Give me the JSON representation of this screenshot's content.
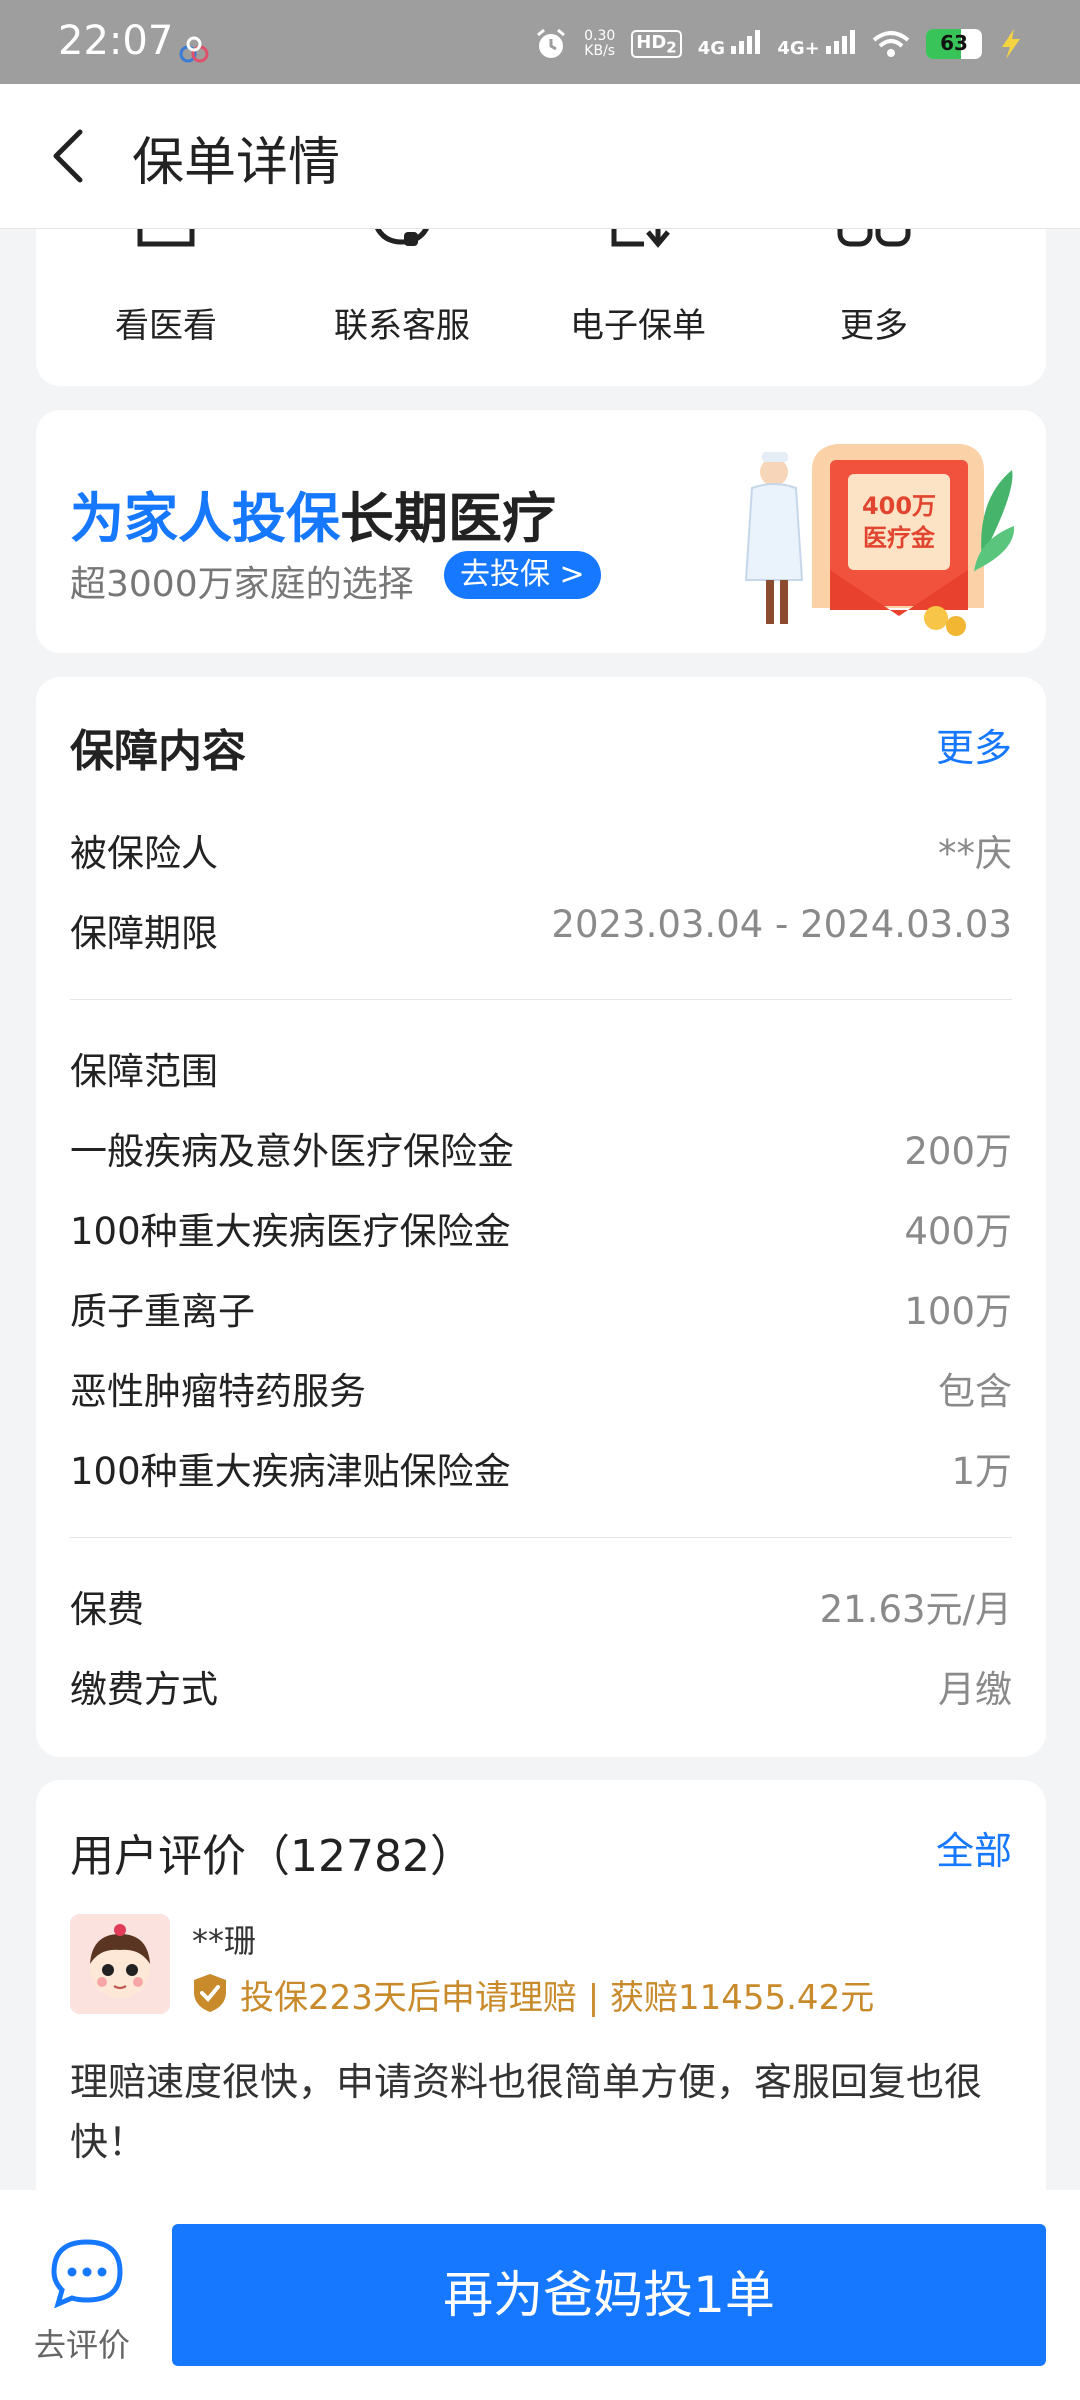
{
  "status_bar": {
    "time": "22:07",
    "net_speed_value": "0.30",
    "net_speed_unit": "KB/s",
    "hd": "HD",
    "hd_sub": "2",
    "signal1": "4G",
    "signal2": "4G+",
    "battery": "63",
    "battery_level_percent": 63
  },
  "header": {
    "title": "保单详情"
  },
  "quick_actions": [
    {
      "label": "看医看",
      "icon": "clipboard-icon"
    },
    {
      "label": "联系客服",
      "icon": "headset-icon"
    },
    {
      "label": "电子保单",
      "icon": "document-download-icon"
    },
    {
      "label": "更多",
      "icon": "more-grid-icon"
    }
  ],
  "promo": {
    "title_highlight": "为家人投保",
    "title_rest": "长期医疗",
    "subtitle": "超3000万家庭的选择",
    "button": "去投保 >",
    "art_line1": "400万",
    "art_line2": "医疗金"
  },
  "coverage": {
    "title": "保障内容",
    "more": "更多",
    "insured_label": "被保险人",
    "insured_value": "**庆",
    "period_label": "保障期限",
    "period_value": "2023.03.04 - 2024.03.03",
    "scope_label": "保障范围",
    "items": [
      {
        "name": "一般疾病及意外医疗保险金",
        "value": "200万"
      },
      {
        "name": "100种重大疾病医疗保险金",
        "value": "400万"
      },
      {
        "name": "质子重离子",
        "value": "100万"
      },
      {
        "name": "恶性肿瘤特药服务",
        "value": "包含"
      },
      {
        "name": "100种重大疾病津贴保险金",
        "value": "1万"
      }
    ],
    "premium_label": "保费",
    "premium_value": "21.63元/月",
    "payment_label": "缴费方式",
    "payment_value": "月缴"
  },
  "reviews": {
    "title": "用户评价（12782）",
    "all": "全部",
    "items": [
      {
        "name": "**珊",
        "badge": "投保223天后申请理赔 | 获赔11455.42元",
        "text": "理赔速度很快，申请资料也很简单方便，客服回复也很快！"
      }
    ]
  },
  "bottom": {
    "comment_label": "去评价",
    "cta": "再为爸妈投1单"
  },
  "colors": {
    "accent": "#1677ff",
    "badge": "#c88a2a",
    "status_bar": "#9e9e9e"
  }
}
